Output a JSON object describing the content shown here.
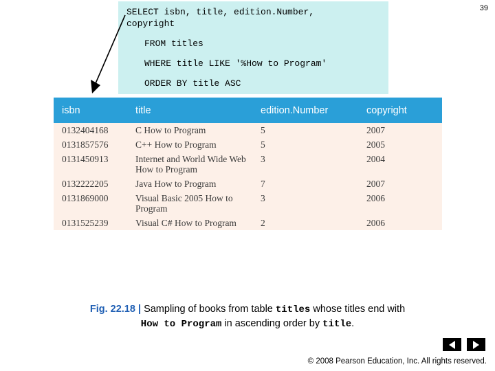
{
  "slide": {
    "number": "39",
    "footer": "© 2008 Pearson Education, Inc.  All rights reserved."
  },
  "sql": {
    "line1": "SELECT isbn, title, edition.Number,",
    "line2": "copyright",
    "line3": "FROM titles",
    "line4": "WHERE title LIKE '%How to Program'",
    "line5": "ORDER BY title ASC"
  },
  "table": {
    "headers": {
      "isbn": "isbn",
      "title": "title",
      "edition": "edition.Number",
      "copyright": "copyright"
    },
    "rows": [
      {
        "isbn": "0132404168",
        "title": "C How to Program",
        "edition": "5",
        "copyright": "2007"
      },
      {
        "isbn": "0131857576",
        "title": "C++ How to Program",
        "edition": "5",
        "copyright": "2005"
      },
      {
        "isbn": "0131450913",
        "title": "Internet and World Wide Web How to Program",
        "edition": "3",
        "copyright": "2004"
      },
      {
        "isbn": "0132222205",
        "title": "Java How to Program",
        "edition": "7",
        "copyright": "2007"
      },
      {
        "isbn": "0131869000",
        "title": "Visual Basic 2005 How to Program",
        "edition": "3",
        "copyright": "2006"
      },
      {
        "isbn": "0131525239",
        "title": "Visual C# How to Program",
        "edition": "2",
        "copyright": "2006"
      }
    ]
  },
  "caption": {
    "fig_label": "Fig. 22.18",
    "separator": "|",
    "text_1": "Sampling of books from table",
    "mono_1": "titles",
    "text_2": "whose titles end with",
    "mono_2": "How to Program",
    "text_3": "in ascending order by",
    "mono_3": "title",
    "period": "."
  },
  "nav": {
    "prev_label": "previous-slide",
    "next_label": "next-slide"
  }
}
